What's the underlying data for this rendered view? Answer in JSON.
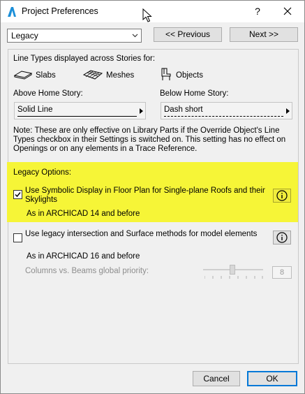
{
  "window": {
    "title": "Project Preferences",
    "help": "?",
    "close_icon": "close-icon"
  },
  "nav": {
    "category": "Legacy",
    "previous": "<< Previous",
    "next": "Next >>"
  },
  "line_types": {
    "heading": "Line Types displayed across Stories for:",
    "items": [
      {
        "label": "Slabs",
        "icon": "slab-icon"
      },
      {
        "label": "Meshes",
        "icon": "mesh-icon"
      },
      {
        "label": "Objects",
        "icon": "object-chair-icon"
      }
    ],
    "above_label": "Above Home Story:",
    "above_value": "Solid Line",
    "below_label": "Below Home Story:",
    "below_value": "Dash short",
    "note": "Note: These are only effective on Library Parts if the Override Object's Line Types checkbox in their Settings is switched on. This setting has no effect on Openings or on any elements in a Trace Reference."
  },
  "legacy": {
    "heading": "Legacy Options:",
    "highlight_color": "#f6f537",
    "option1_label": "Use Symbolic Display in Floor Plan for Single-plane Roofs and their Skylights",
    "option1_checked": true,
    "option1_sub": "As in ARCHICAD 14 and before",
    "option2_label": "Use legacy intersection and Surface methods for model elements",
    "option2_checked": false,
    "option2_sub": "As in ARCHICAD 16 and before",
    "priority_label": "Columns vs. Beams global priority:",
    "priority_value": "8"
  },
  "footer": {
    "cancel": "Cancel",
    "ok": "OK"
  }
}
